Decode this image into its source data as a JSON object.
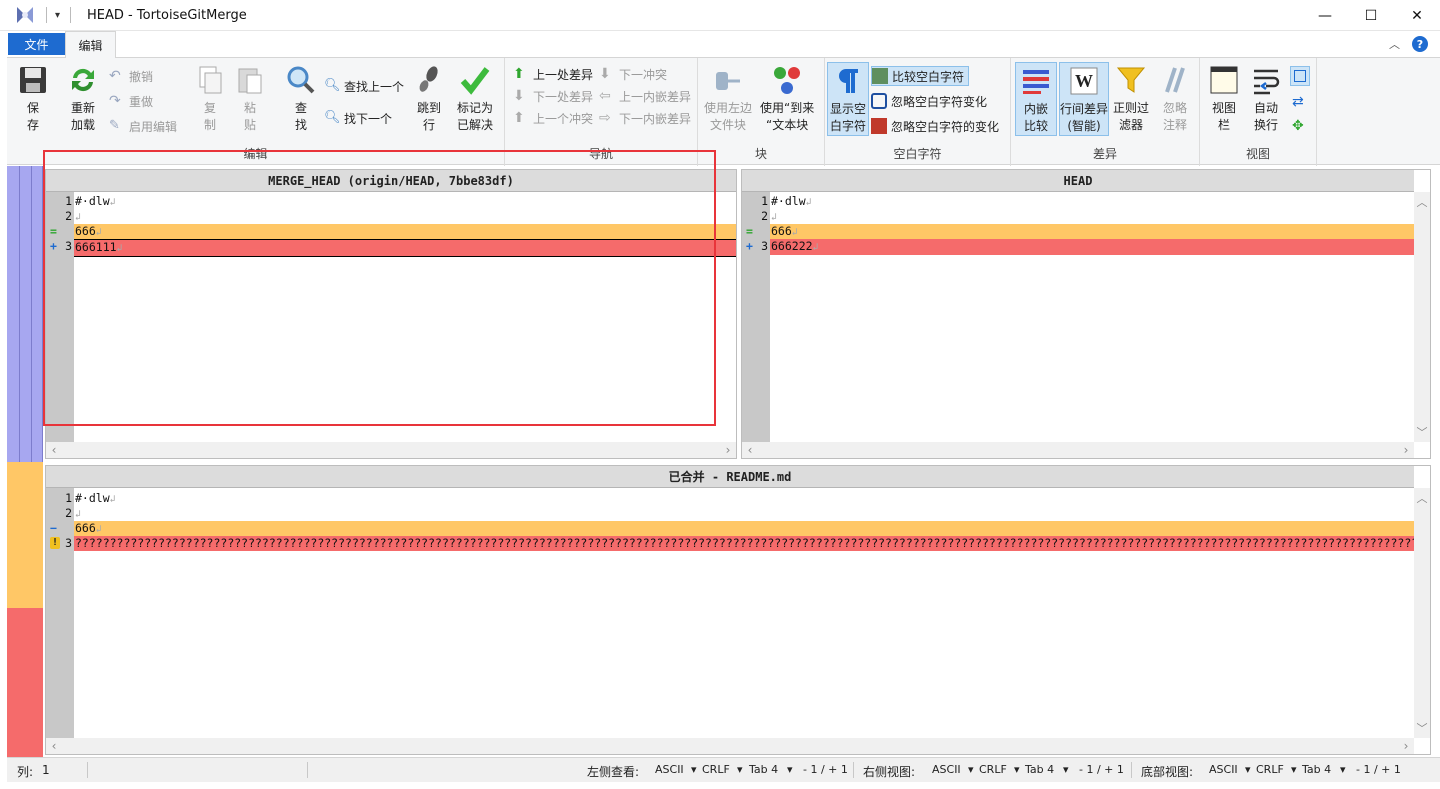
{
  "window": {
    "title": "HEAD - TortoiseGitMerge",
    "minimize": "—",
    "maximize": "☐",
    "close": "✕"
  },
  "tabs": {
    "file": "文件",
    "edit": "编辑"
  },
  "ribbon": {
    "edit_group": {
      "label": "编辑",
      "save": [
        "保",
        "存"
      ],
      "reload": [
        "重新",
        "加载"
      ],
      "undo": "撤销",
      "redo": "重做",
      "enable_edit": "启用编辑",
      "copy": [
        "复",
        "制"
      ],
      "paste": [
        "粘",
        "贴"
      ],
      "find": [
        "查",
        "找"
      ],
      "find_prev": "查找上一个",
      "find_next": "找下一个",
      "goto": [
        "跳到",
        "行"
      ],
      "mark_resolved": [
        "标记为",
        "已解决"
      ]
    },
    "nav_group": {
      "label": "导航",
      "prev_diff": "上一处差异",
      "next_diff": "下一处差异",
      "prev_conflict": "上一个冲突",
      "next_conflict": "下一冲突",
      "prev_inline": "上一内嵌差异",
      "next_inline": "下一内嵌差异"
    },
    "block_group": {
      "label": "块",
      "use_left": [
        "使用左边",
        "文件块"
      ],
      "use_this": [
        "使用“到来",
        "“文本块"
      ]
    },
    "ws_group": {
      "label": "空白字符",
      "show_ws": [
        "显示空",
        "白字符"
      ],
      "compare_ws": "比较空白字符",
      "ignore_ws_change": "忽略空白字符变化",
      "ignore_all_ws": "忽略空白字符的变化"
    },
    "diff_group": {
      "label": "差异",
      "inline": [
        "内嵌",
        "比较"
      ],
      "line_diff": [
        "行间差异",
        "(智能)"
      ],
      "regex": [
        "正则过",
        "滤器"
      ],
      "ignore_comments": [
        "忽略",
        "注释"
      ]
    },
    "view_group": {
      "label": "视图",
      "viewbar": [
        "视图",
        "栏"
      ],
      "autowrap": [
        "自动",
        "换行"
      ]
    }
  },
  "panes": {
    "left": {
      "header": "MERGE_HEAD (origin/HEAD, 7bbe83df)",
      "lines": [
        {
          "num": "1",
          "mark": "",
          "text": "#·dlw"
        },
        {
          "num": "2",
          "mark": "",
          "text": ""
        },
        {
          "num": "",
          "mark": "=",
          "text": "666"
        },
        {
          "num": "3",
          "mark": "+",
          "text": "666111"
        }
      ]
    },
    "right": {
      "header": "HEAD",
      "lines": [
        {
          "num": "1",
          "mark": "",
          "text": "#·dlw"
        },
        {
          "num": "2",
          "mark": "",
          "text": ""
        },
        {
          "num": "",
          "mark": "=",
          "text": "666"
        },
        {
          "num": "3",
          "mark": "+",
          "text": "666222"
        }
      ]
    },
    "bottom": {
      "header": "已合并 - README.md",
      "lines": [
        {
          "num": "1",
          "mark": "",
          "text": "#·dlw"
        },
        {
          "num": "2",
          "mark": "",
          "text": ""
        },
        {
          "num": "",
          "mark": "−",
          "text": "666"
        },
        {
          "num": "3",
          "mark": "!",
          "text": "????????????????????????????????????????????????????????????????????????????????????????????????????????????????????????????????????????????????????????????????????????????????????????????????????????????????????"
        }
      ]
    }
  },
  "status": {
    "col_label": "列:",
    "col_value": "1",
    "left_view": "左侧查看:",
    "right_view": "右侧视图:",
    "bottom_view": "底部视图:",
    "encoding": "ASCII",
    "eol": "CRLF",
    "tab": "Tab 4",
    "changes": "- 1 / + 1"
  },
  "colors": {
    "conflict_orange": "#ffc766",
    "removed_red": "#f56b6b",
    "locbar_blue": "#a7a7f0",
    "accent": "#1e6bd0"
  }
}
